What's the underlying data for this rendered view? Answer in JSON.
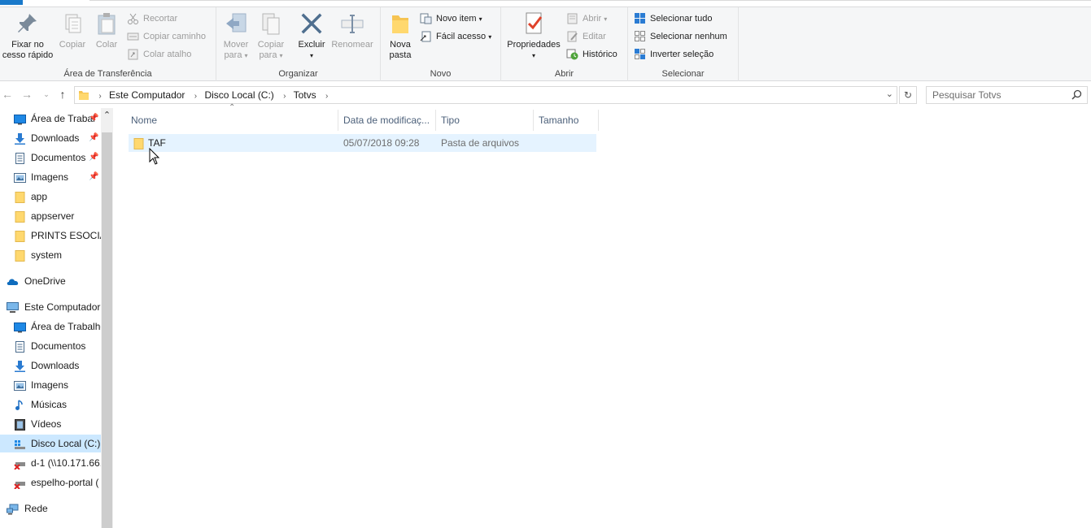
{
  "ribbon": {
    "groups": {
      "clipboard": {
        "label": "Área de Transferência",
        "pin_line1": "Fixar no",
        "pin_line2": "cesso rápido",
        "copy": "Copiar",
        "paste": "Colar",
        "cut": "Recortar",
        "copy_path": "Copiar caminho",
        "paste_shortcut": "Colar atalho"
      },
      "organize": {
        "label": "Organizar",
        "move_line1": "Mover",
        "move_line2": "para",
        "copyto_line1": "Copiar",
        "copyto_line2": "para",
        "delete": "Excluir",
        "rename": "Renomear"
      },
      "new": {
        "label": "Novo",
        "new_folder_line1": "Nova",
        "new_folder_line2": "pasta",
        "new_item": "Novo item",
        "easy_access": "Fácil acesso"
      },
      "open": {
        "label": "Abrir",
        "properties": "Propriedades",
        "open": "Abrir",
        "edit": "Editar",
        "history": "Histórico"
      },
      "select": {
        "label": "Selecionar",
        "select_all": "Selecionar tudo",
        "select_none": "Selecionar nenhum",
        "invert": "Inverter seleção"
      }
    }
  },
  "address": {
    "crumbs": [
      "Este Computador",
      "Disco Local (C:)",
      "Totvs"
    ],
    "search_placeholder": "Pesquisar Totvs"
  },
  "navpane": {
    "quick_access": [
      {
        "label": "Área de Trabal",
        "icon": "desktop-icon",
        "pinned": true
      },
      {
        "label": "Downloads",
        "icon": "download-icon",
        "pinned": true
      },
      {
        "label": "Documentos",
        "icon": "documents-icon",
        "pinned": true
      },
      {
        "label": "Imagens",
        "icon": "pictures-icon",
        "pinned": true
      },
      {
        "label": "app",
        "icon": "folder-icon"
      },
      {
        "label": "appserver",
        "icon": "folder-icon"
      },
      {
        "label": "PRINTS ESOCIAL",
        "icon": "folder-icon"
      },
      {
        "label": "system",
        "icon": "folder-icon"
      }
    ],
    "onedrive": "OneDrive",
    "this_pc": "Este Computador",
    "pc_items": [
      {
        "label": "Área de Trabalho",
        "icon": "desktop-icon"
      },
      {
        "label": "Documentos",
        "icon": "documents-icon"
      },
      {
        "label": "Downloads",
        "icon": "download-icon"
      },
      {
        "label": "Imagens",
        "icon": "pictures-icon"
      },
      {
        "label": "Músicas",
        "icon": "music-icon"
      },
      {
        "label": "Vídeos",
        "icon": "videos-icon"
      },
      {
        "label": "Disco Local (C:)",
        "icon": "drive-icon",
        "selected": true
      },
      {
        "label": "d-1 (\\\\10.171.66.",
        "icon": "network-drive-disconnected-icon"
      },
      {
        "label": "espelho-portal (",
        "icon": "network-drive-disconnected-icon"
      }
    ],
    "network": "Rede"
  },
  "filelist": {
    "columns": [
      "Nome",
      "Data de modificaç...",
      "Tipo",
      "Tamanho"
    ],
    "rows": [
      {
        "name": "TAF",
        "modified": "05/07/2018 09:28",
        "type": "Pasta de arquivos",
        "size": ""
      }
    ]
  },
  "colors": {
    "accent": "#1979ca",
    "selection": "#cce8ff",
    "hover": "#e5f3ff",
    "folder": "#ffd86e"
  }
}
